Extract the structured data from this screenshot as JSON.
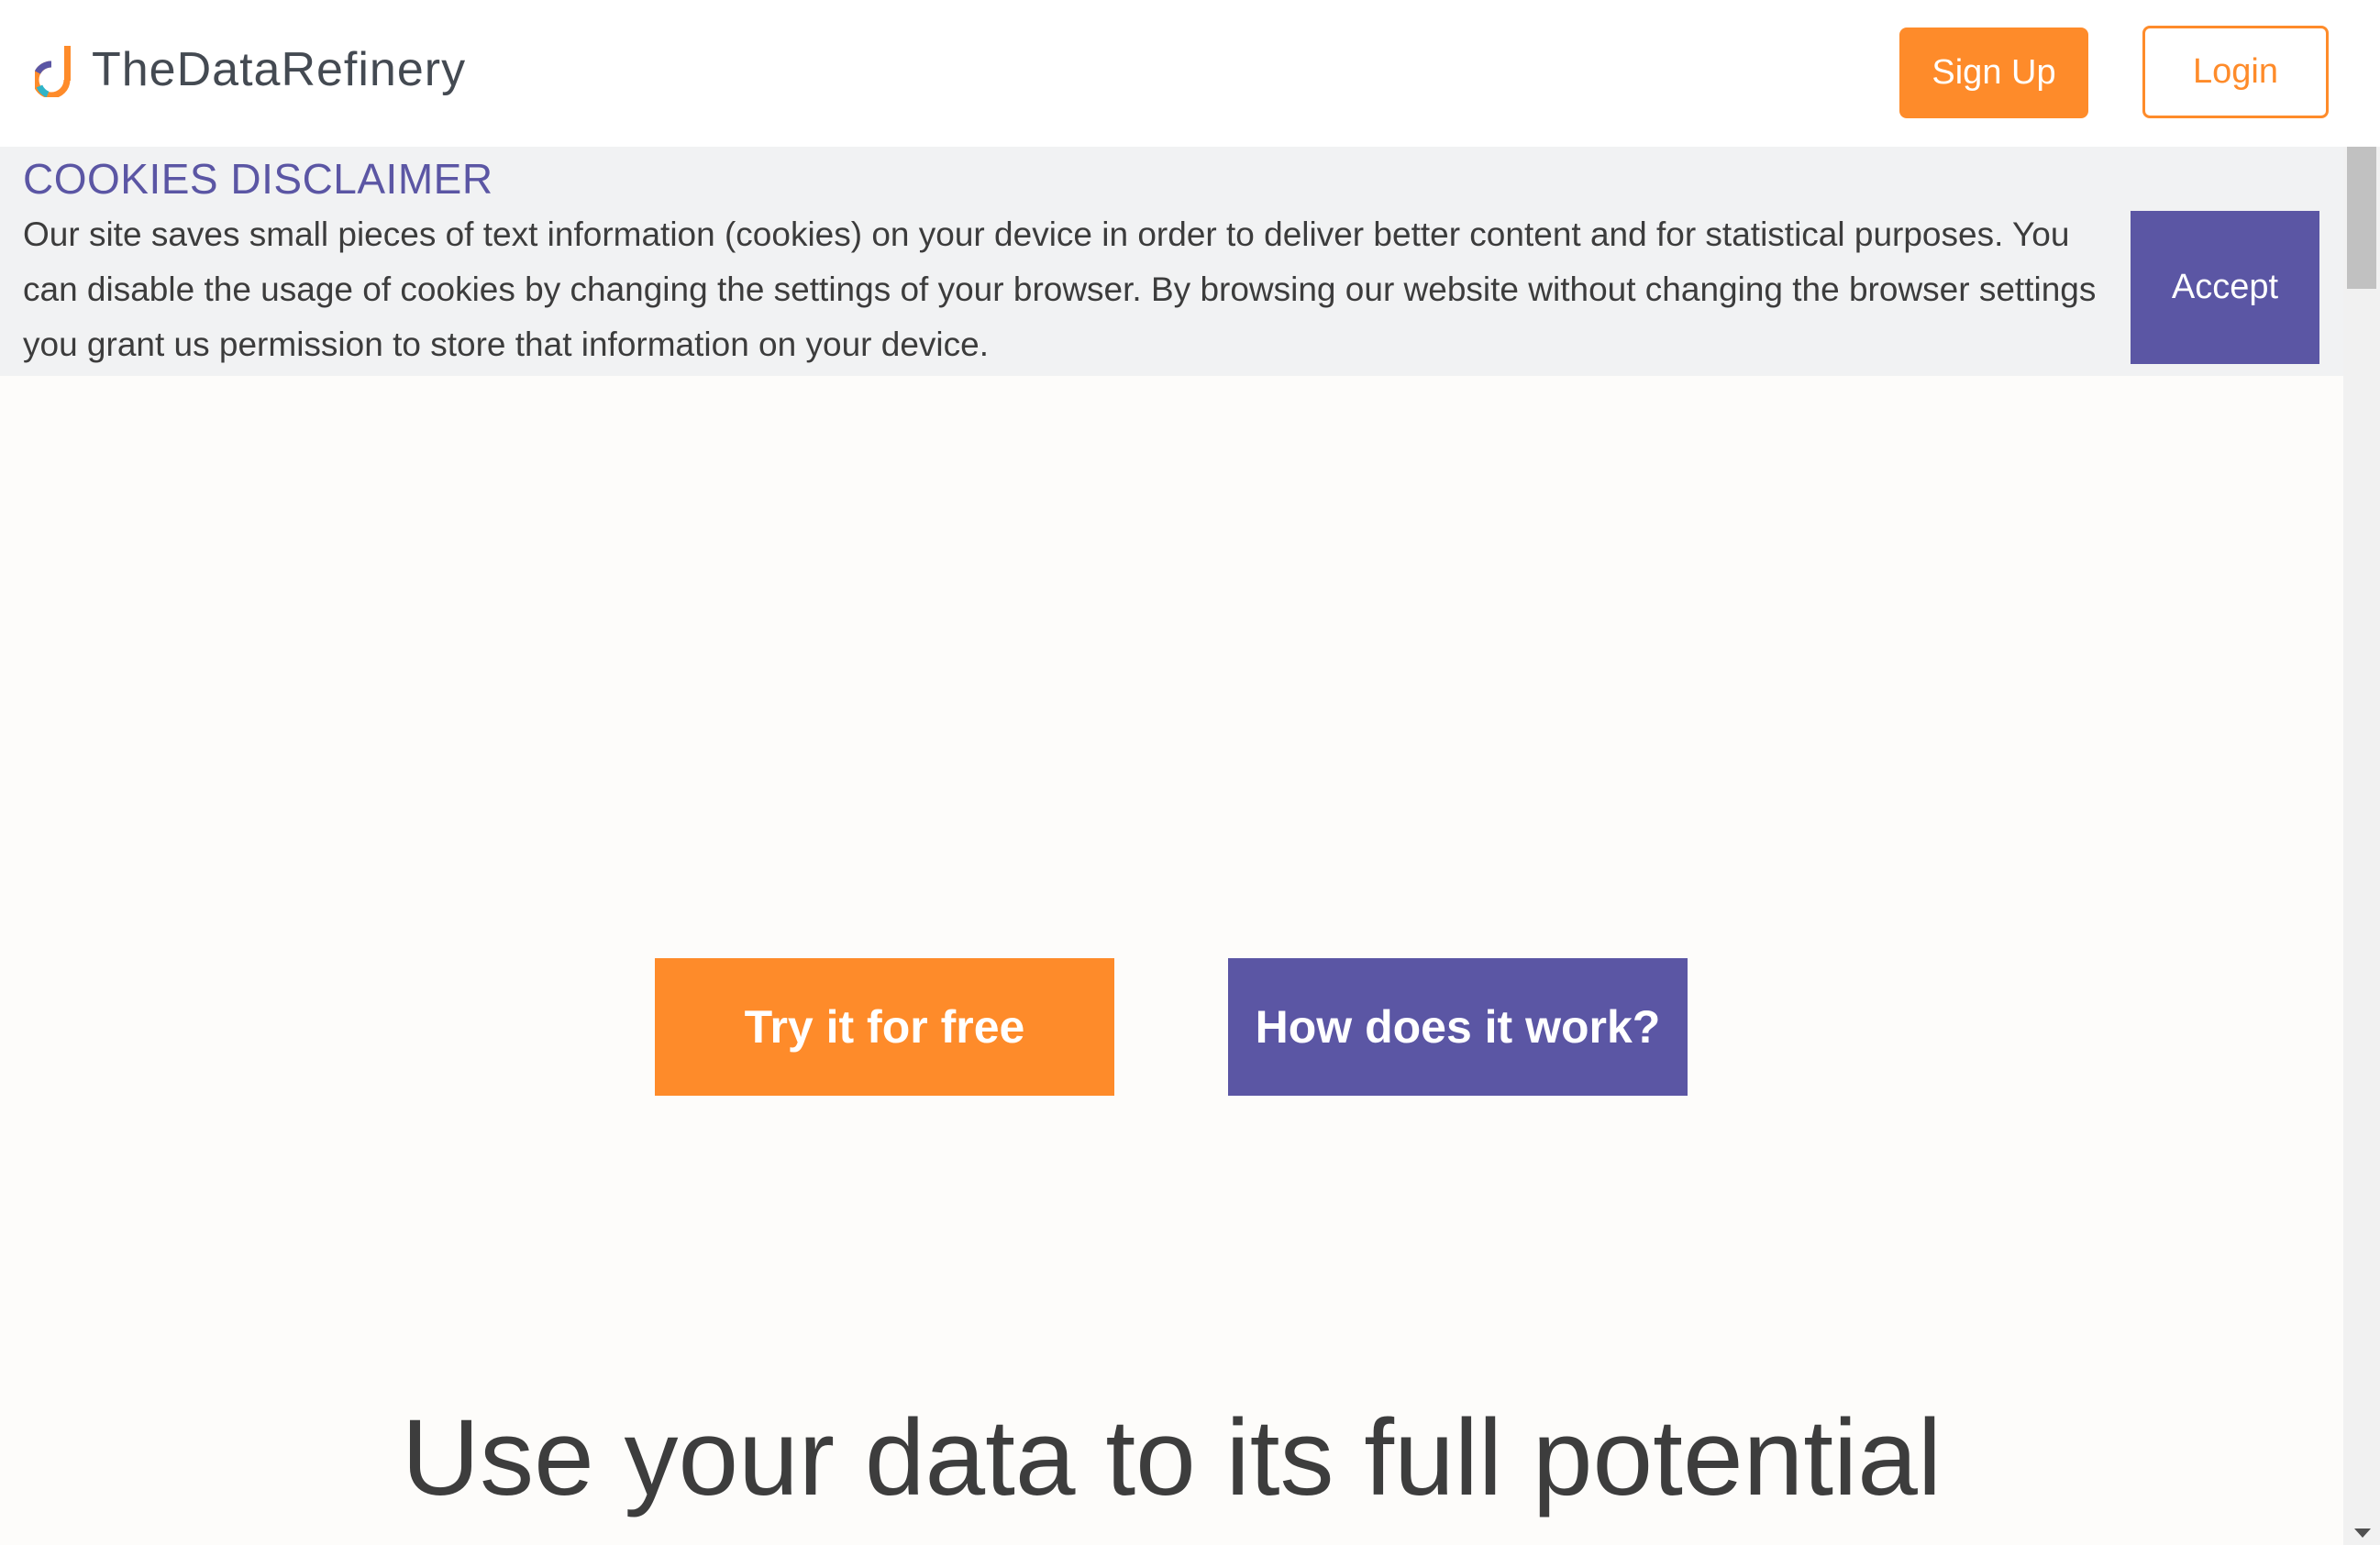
{
  "header": {
    "logo_text": "TheDataRefinery",
    "signup_label": "Sign Up",
    "login_label": "Login"
  },
  "cookie_banner": {
    "title": "COOKIES DISCLAIMER",
    "text": "Our site saves small pieces of text information (cookies) on your device in order to deliver better content and for statistical purposes. You can disable the usage of cookies by changing the settings of your browser. By browsing our website without changing the browser settings you grant us permission to store that information on your device.",
    "accept_label": "Accept"
  },
  "hero": {
    "try_label": "Try it for free",
    "how_label": "How does it work?",
    "headline": "Use your data to its full potential"
  },
  "colors": {
    "brand_orange": "#fe8b2a",
    "brand_purple": "#5b56a4"
  },
  "icons": {
    "logo": "data-refinery-logo-icon"
  }
}
